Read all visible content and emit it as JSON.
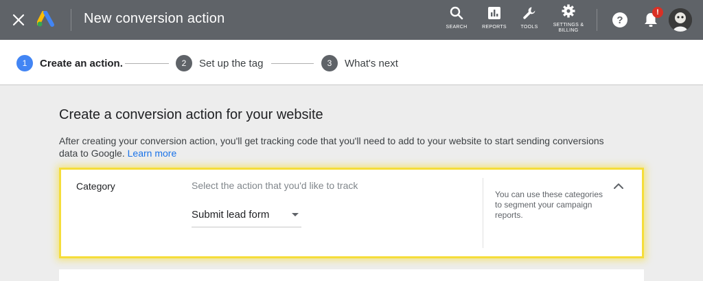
{
  "header": {
    "title": "New conversion action",
    "tools": {
      "search": "SEARCH",
      "reports": "REPORTS",
      "tools": "TOOLS",
      "settings_line1": "SETTINGS &",
      "settings_line2": "BILLING"
    },
    "notification_badge": "!"
  },
  "stepper": {
    "steps": [
      {
        "num": "1",
        "label": "Create an action."
      },
      {
        "num": "2",
        "label": "Set up the tag"
      },
      {
        "num": "3",
        "label": "What's next"
      }
    ]
  },
  "main": {
    "heading": "Create a conversion action for your website",
    "description": "After creating your conversion action, you'll get tracking code that you'll need to add to your website to start sending conversions data to Google.",
    "learn_more": "Learn more",
    "category_card": {
      "label": "Category",
      "select_hint": "Select the action that you'd like to track",
      "selected_value": "Submit lead form",
      "help_text": "You can use these categories to segment your campaign reports."
    }
  },
  "colors": {
    "topbar": "#5f6368",
    "accent_blue": "#4285f4",
    "link_blue": "#1a73e8",
    "highlight_yellow": "#f5dd3a",
    "alert_red": "#d93025"
  },
  "icons": [
    "close-icon",
    "google-ads-logo",
    "search-icon",
    "reports-icon",
    "wrench-icon",
    "gear-icon",
    "help-icon",
    "bell-icon",
    "chevron-up-icon",
    "dropdown-caret-icon"
  ]
}
